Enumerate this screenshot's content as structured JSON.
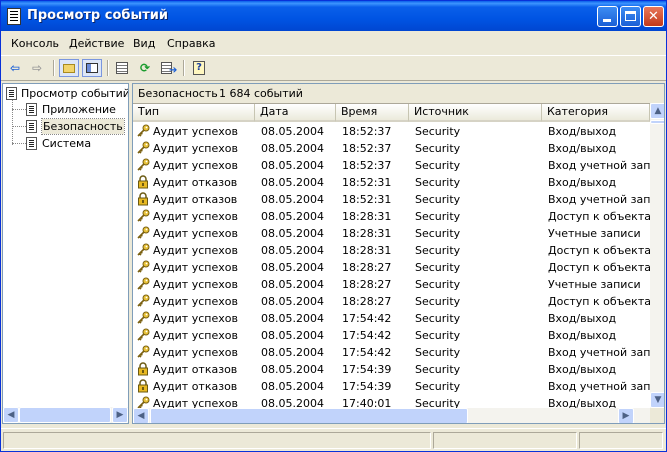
{
  "window": {
    "title": "Просмотр событий"
  },
  "menu": [
    "Консоль",
    "Действие",
    "Вид",
    "Справка"
  ],
  "toolbar": {
    "icons": [
      "back-arrow-icon",
      "forward-arrow-icon",
      "up-folder-icon",
      "show-hide-tree-icon",
      "properties-icon",
      "refresh-icon",
      "export-list-icon",
      "help-icon"
    ]
  },
  "tree": {
    "root": "Просмотр событий (.",
    "children": [
      "Приложение",
      "Безопасность",
      "Система"
    ],
    "selected": "Безопасность"
  },
  "pane": {
    "name": "Безопасность",
    "count": "1 684 событий"
  },
  "columns": [
    "Тип",
    "Дата",
    "Время",
    "Источник",
    "Категория"
  ],
  "rows": [
    {
      "type": "Аудит успехов",
      "kind": "success",
      "date": "08.05.2004",
      "time": "18:52:37",
      "source": "Security",
      "category": "Вход/выход"
    },
    {
      "type": "Аудит успехов",
      "kind": "success",
      "date": "08.05.2004",
      "time": "18:52:37",
      "source": "Security",
      "category": "Вход/выход"
    },
    {
      "type": "Аудит успехов",
      "kind": "success",
      "date": "08.05.2004",
      "time": "18:52:37",
      "source": "Security",
      "category": "Вход учетной запис"
    },
    {
      "type": "Аудит отказов",
      "kind": "failure",
      "date": "08.05.2004",
      "time": "18:52:31",
      "source": "Security",
      "category": "Вход/выход"
    },
    {
      "type": "Аудит отказов",
      "kind": "failure",
      "date": "08.05.2004",
      "time": "18:52:31",
      "source": "Security",
      "category": "Вход учетной запис"
    },
    {
      "type": "Аудит успехов",
      "kind": "success",
      "date": "08.05.2004",
      "time": "18:28:31",
      "source": "Security",
      "category": "Доступ к объектам"
    },
    {
      "type": "Аудит успехов",
      "kind": "success",
      "date": "08.05.2004",
      "time": "18:28:31",
      "source": "Security",
      "category": "Учетные записи"
    },
    {
      "type": "Аудит успехов",
      "kind": "success",
      "date": "08.05.2004",
      "time": "18:28:31",
      "source": "Security",
      "category": "Доступ к объектам"
    },
    {
      "type": "Аудит успехов",
      "kind": "success",
      "date": "08.05.2004",
      "time": "18:28:27",
      "source": "Security",
      "category": "Доступ к объектам"
    },
    {
      "type": "Аудит успехов",
      "kind": "success",
      "date": "08.05.2004",
      "time": "18:28:27",
      "source": "Security",
      "category": "Учетные записи"
    },
    {
      "type": "Аудит успехов",
      "kind": "success",
      "date": "08.05.2004",
      "time": "18:28:27",
      "source": "Security",
      "category": "Доступ к объектам"
    },
    {
      "type": "Аудит успехов",
      "kind": "success",
      "date": "08.05.2004",
      "time": "17:54:42",
      "source": "Security",
      "category": "Вход/выход"
    },
    {
      "type": "Аудит успехов",
      "kind": "success",
      "date": "08.05.2004",
      "time": "17:54:42",
      "source": "Security",
      "category": "Вход/выход"
    },
    {
      "type": "Аудит успехов",
      "kind": "success",
      "date": "08.05.2004",
      "time": "17:54:42",
      "source": "Security",
      "category": "Вход учетной запис"
    },
    {
      "type": "Аудит отказов",
      "kind": "failure",
      "date": "08.05.2004",
      "time": "17:54:39",
      "source": "Security",
      "category": "Вход/выход"
    },
    {
      "type": "Аудит отказов",
      "kind": "failure",
      "date": "08.05.2004",
      "time": "17:54:39",
      "source": "Security",
      "category": "Вход учетной запис"
    },
    {
      "type": "Аудит успехов",
      "kind": "success",
      "date": "08.05.2004",
      "time": "17:40:01",
      "source": "Security",
      "category": "Вход/выход"
    }
  ],
  "colors": {
    "titlebar": "#0054e3",
    "chrome": "#ece9d8",
    "pane_border": "#7f9db9",
    "key": "#d4a017"
  }
}
